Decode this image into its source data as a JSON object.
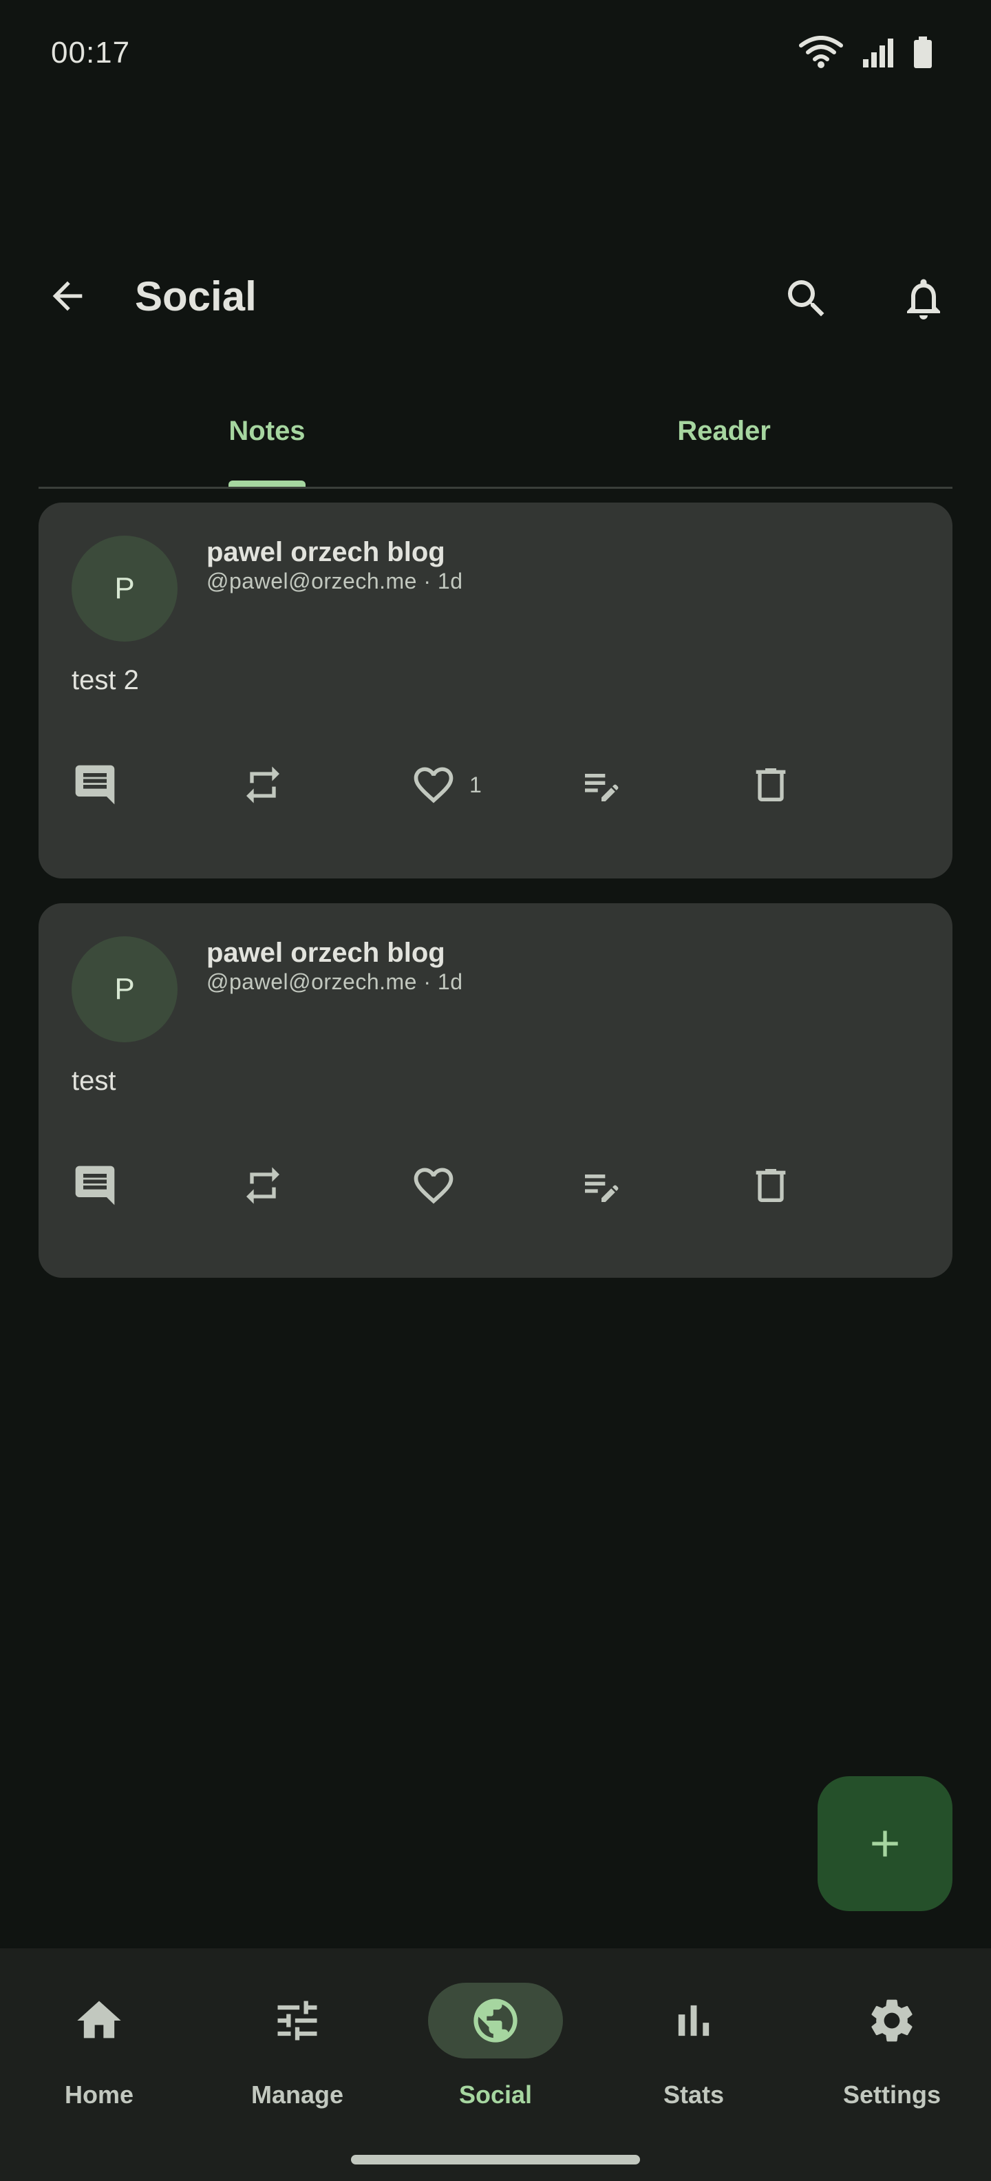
{
  "status_bar": {
    "time": "00:17"
  },
  "app_bar": {
    "title": "Social"
  },
  "tabs": [
    {
      "label": "Notes",
      "selected": true
    },
    {
      "label": "Reader",
      "selected": false
    }
  ],
  "notes": [
    {
      "avatar_initial": "P",
      "author": "pawel orzech blog",
      "handle": "@pawel@orzech.me",
      "age": "1d",
      "meta": "@pawel@orzech.me · 1d",
      "text": "test 2",
      "likes": "1"
    },
    {
      "avatar_initial": "P",
      "author": "pawel orzech blog",
      "handle": "@pawel@orzech.me",
      "age": "1d",
      "meta": "@pawel@orzech.me · 1d",
      "text": "test",
      "likes": ""
    }
  ],
  "bottom_nav": [
    {
      "label": "Home",
      "icon": "home-icon",
      "active": false
    },
    {
      "label": "Manage",
      "icon": "tune-icon",
      "active": false
    },
    {
      "label": "Social",
      "icon": "globe-icon",
      "active": true
    },
    {
      "label": "Stats",
      "icon": "bar-chart-icon",
      "active": false
    },
    {
      "label": "Settings",
      "icon": "gear-icon",
      "active": false
    }
  ],
  "colors": {
    "background": "#101411",
    "card": "#333633",
    "accent": "#a6d6a0",
    "fab": "#25502a",
    "nav_background": "#1d201d",
    "avatar": "#3c4b3b"
  }
}
